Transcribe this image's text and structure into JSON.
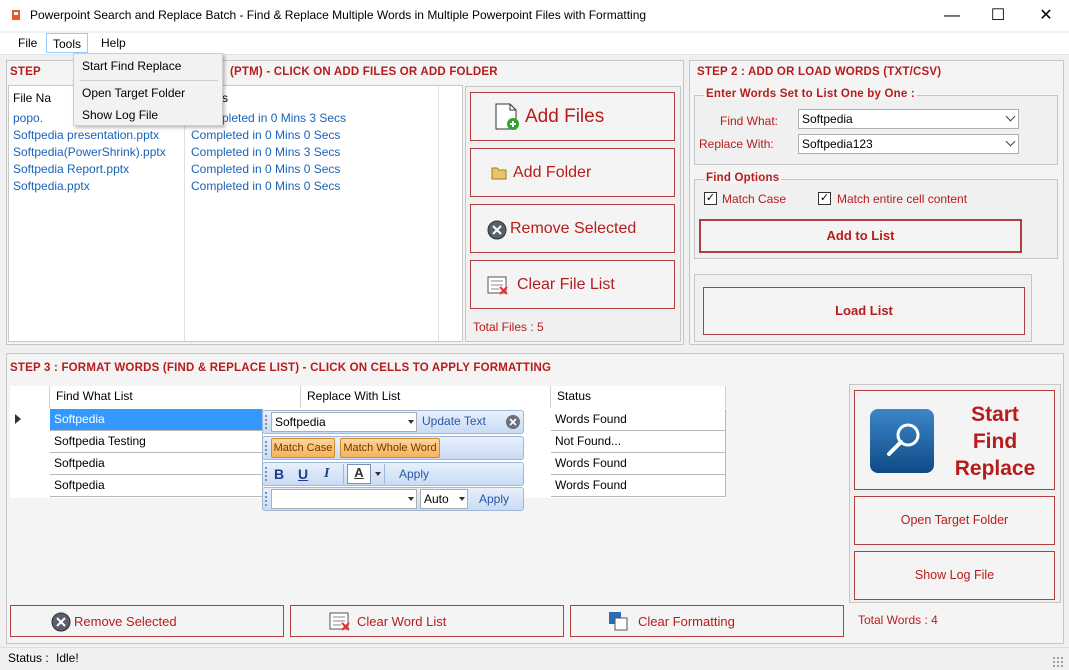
{
  "window": {
    "title": "Powerpoint Search and Replace Batch - Find & Replace Multiple Words in Multiple Powerpoint Files with Formatting",
    "minimize": "—",
    "maximize": "☐",
    "close": "✕"
  },
  "menubar": {
    "file": "File",
    "tools": "Tools",
    "help": "Help"
  },
  "tools_menu": {
    "items": [
      "Start Find Replace",
      "Open Target Folder",
      "Show Log File"
    ]
  },
  "step1": {
    "header_left": "STEP",
    "header_right": "(PTM) - CLICK ON ADD FILES OR ADD FOLDER",
    "col_file_partial": "File Na",
    "col_status_partial": "s",
    "rows": [
      {
        "file": "popo.",
        "status": "pleted in 0 Mins 3 Secs"
      },
      {
        "file": "Softpedia presentation.pptx",
        "status": "Completed in 0 Mins 0 Secs"
      },
      {
        "file": "Softpedia(PowerShrink).pptx",
        "status": "Completed in 0 Mins 3 Secs"
      },
      {
        "file": "Softpedia Report.pptx",
        "status": "Completed in 0 Mins 0 Secs"
      },
      {
        "file": "Softpedia.pptx",
        "status": "Completed in 0 Mins 0 Secs"
      }
    ],
    "add_files": "Add Files",
    "add_folder": "Add Folder",
    "remove_selected": "Remove Selected",
    "clear_file_list": "Clear File List",
    "total_files": "Total Files : 5"
  },
  "step2": {
    "header": "STEP 2 : ADD OR LOAD WORDS (TXT/CSV)",
    "group_title": "Enter Words Set to List One by One :",
    "find_label": "Find What:",
    "find_value": "Softpedia",
    "replace_label": "Replace With:",
    "replace_value": "Softpedia123",
    "options_title": "Find Options",
    "match_case": "Match Case",
    "match_entire": "Match entire cell content",
    "add_to_list": "Add to List",
    "load_list": "Load List"
  },
  "step3": {
    "header": "STEP 3 : FORMAT WORDS (FIND & REPLACE LIST) - CLICK ON CELLS TO APPLY FORMATTING",
    "columns": [
      "Find What List",
      "Replace With List",
      "Status"
    ],
    "rows": [
      {
        "find": "Softpedia",
        "status": "Words Found"
      },
      {
        "find": "Softpedia Testing",
        "status": "Not Found..."
      },
      {
        "find": "Softpedia",
        "status": "Words Found"
      },
      {
        "find": "Softpedia",
        "status": "Words Found"
      }
    ],
    "popup": {
      "text_value": "Softpedia",
      "update_text": "Update Text",
      "match_case": "Match Case",
      "match_whole_word": "Match Whole Word",
      "bold": "B",
      "underline": "U",
      "italic": "I",
      "font_color": "A",
      "apply1": "Apply",
      "size_value": "Auto",
      "apply2": "Apply"
    },
    "start_line1": "Start",
    "start_line2": "Find",
    "start_line3": "Replace",
    "open_target_folder": "Open Target Folder",
    "show_log_file": "Show Log File",
    "total_words": "Total Words : 4",
    "remove_selected": "Remove Selected",
    "clear_word_list": "Clear Word List",
    "clear_formatting": "Clear Formatting"
  },
  "status": {
    "label": "Status :",
    "value": "Idle!"
  },
  "colors": {
    "accent_red": "#b71c1c",
    "link_blue": "#1a63b8",
    "selection_blue": "#3399ff",
    "orange": "#f7b25b"
  }
}
